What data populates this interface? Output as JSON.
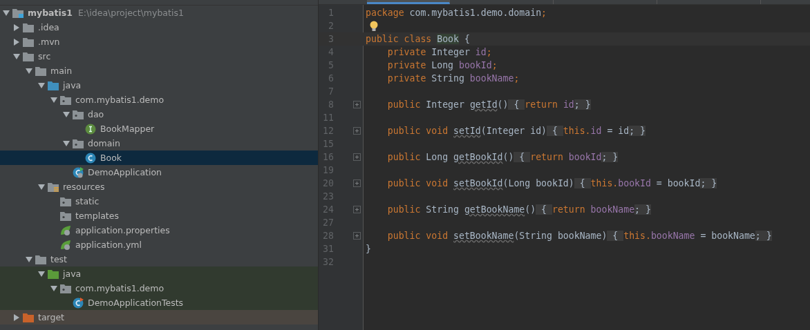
{
  "editor_tabs": [
    {
      "selected": true
    },
    {
      "selected": false
    },
    {
      "selected": false
    },
    {
      "selected": false
    }
  ],
  "project_tree": [
    {
      "label": "mybatis1",
      "path": "E:\\idea\\project\\mybatis1",
      "kind": "module",
      "expanded": true,
      "selected": false,
      "children": [
        {
          "label": ".idea",
          "kind": "folder",
          "expanded": false,
          "selected": false
        },
        {
          "label": ".mvn",
          "kind": "folder",
          "expanded": false,
          "selected": false
        },
        {
          "label": "src",
          "kind": "folder",
          "expanded": true,
          "selected": false,
          "children": [
            {
              "label": "main",
              "kind": "folder",
              "expanded": true,
              "selected": false,
              "children": [
                {
                  "label": "java",
                  "kind": "source",
                  "expanded": true,
                  "selected": false,
                  "children": [
                    {
                      "label": "com.mybatis1.demo",
                      "kind": "package",
                      "expanded": true,
                      "selected": false,
                      "children": [
                        {
                          "label": "dao",
                          "kind": "package",
                          "expanded": true,
                          "selected": false,
                          "children": [
                            {
                              "label": "BookMapper",
                              "kind": "interface",
                              "selected": false
                            }
                          ]
                        },
                        {
                          "label": "domain",
                          "kind": "package",
                          "expanded": true,
                          "selected": false,
                          "children": [
                            {
                              "label": "Book",
                              "kind": "class",
                              "selected": true
                            }
                          ]
                        },
                        {
                          "label": "DemoApplication",
                          "kind": "application",
                          "selected": false
                        }
                      ]
                    }
                  ]
                },
                {
                  "label": "resources",
                  "kind": "resources",
                  "expanded": true,
                  "selected": false,
                  "children": [
                    {
                      "label": "static",
                      "kind": "package",
                      "selected": false
                    },
                    {
                      "label": "templates",
                      "kind": "package",
                      "selected": false
                    },
                    {
                      "label": "application.properties",
                      "kind": "config",
                      "selected": false
                    },
                    {
                      "label": "application.yml",
                      "kind": "config",
                      "selected": false
                    }
                  ]
                }
              ]
            },
            {
              "label": "test",
              "kind": "folder",
              "expanded": true,
              "selected": false,
              "children": [
                {
                  "label": "java",
                  "kind": "tests",
                  "expanded": true,
                  "selected": false,
                  "test_scope": true,
                  "children": [
                    {
                      "label": "com.mybatis1.demo",
                      "kind": "package",
                      "expanded": true,
                      "selected": false,
                      "test_scope": true,
                      "children": [
                        {
                          "label": "DemoApplicationTests",
                          "kind": "testclass",
                          "selected": false,
                          "test_scope": true
                        }
                      ]
                    }
                  ]
                }
              ]
            }
          ]
        },
        {
          "label": "target",
          "kind": "excluded",
          "expanded": false,
          "selected": false,
          "excluded": true
        }
      ]
    }
  ],
  "code_lines": [
    {
      "number": "1",
      "tokens": [
        {
          "t": "package",
          "kind": "keyword"
        },
        {
          "t": " com.mybatis1.demo.domain",
          "kind": "plain"
        },
        {
          "t": ";",
          "kind": "keyword"
        }
      ]
    },
    {
      "number": "2",
      "bulb": true
    },
    {
      "number": "3",
      "current": true,
      "tokens": [
        {
          "t": "public class ",
          "kind": "keyword"
        },
        {
          "t": "Book",
          "kind": "classname"
        },
        {
          "t": " {",
          "kind": "plain"
        }
      ]
    },
    {
      "number": "4",
      "tokens": [
        {
          "t": "    private ",
          "kind": "keyword"
        },
        {
          "t": "Integer ",
          "kind": "plain"
        },
        {
          "t": "id",
          "kind": "field"
        },
        {
          "t": ";",
          "kind": "keyword"
        }
      ]
    },
    {
      "number": "5",
      "tokens": [
        {
          "t": "    private ",
          "kind": "keyword"
        },
        {
          "t": "Long ",
          "kind": "plain"
        },
        {
          "t": "bookId",
          "kind": "field"
        },
        {
          "t": ";",
          "kind": "keyword"
        }
      ]
    },
    {
      "number": "6",
      "tokens": [
        {
          "t": "    private ",
          "kind": "keyword"
        },
        {
          "t": "String ",
          "kind": "plain"
        },
        {
          "t": "bookName",
          "kind": "field"
        },
        {
          "t": ";",
          "kind": "keyword"
        }
      ]
    },
    {
      "number": "7"
    },
    {
      "number": "8",
      "folded": true,
      "tokens": [
        {
          "t": "    public ",
          "kind": "keyword"
        },
        {
          "t": "Integer ",
          "kind": "plain"
        },
        {
          "t": "getId",
          "kind": "method"
        },
        {
          "t": "()",
          "kind": "plain"
        },
        {
          "t": " { ",
          "kind": "fold"
        },
        {
          "t": "return ",
          "kind": "keyword"
        },
        {
          "t": "id",
          "kind": "field"
        },
        {
          "t": "; }",
          "kind": "fold"
        }
      ]
    },
    {
      "number": "11"
    },
    {
      "number": "12",
      "folded": true,
      "tokens": [
        {
          "t": "    public void ",
          "kind": "keyword"
        },
        {
          "t": "setId",
          "kind": "method"
        },
        {
          "t": "(Integer id)",
          "kind": "plain"
        },
        {
          "t": " { ",
          "kind": "fold"
        },
        {
          "t": "this.",
          "kind": "keyword"
        },
        {
          "t": "id",
          "kind": "field"
        },
        {
          "t": " = id",
          "kind": "plain"
        },
        {
          "t": "; }",
          "kind": "fold"
        }
      ]
    },
    {
      "number": "15"
    },
    {
      "number": "16",
      "folded": true,
      "tokens": [
        {
          "t": "    public ",
          "kind": "keyword"
        },
        {
          "t": "Long ",
          "kind": "plain"
        },
        {
          "t": "getBookId",
          "kind": "method"
        },
        {
          "t": "()",
          "kind": "plain"
        },
        {
          "t": " { ",
          "kind": "fold"
        },
        {
          "t": "return ",
          "kind": "keyword"
        },
        {
          "t": "bookId",
          "kind": "field"
        },
        {
          "t": "; }",
          "kind": "fold"
        }
      ]
    },
    {
      "number": "19"
    },
    {
      "number": "20",
      "folded": true,
      "tokens": [
        {
          "t": "    public void ",
          "kind": "keyword"
        },
        {
          "t": "setBookId",
          "kind": "method"
        },
        {
          "t": "(Long bookId)",
          "kind": "plain"
        },
        {
          "t": " { ",
          "kind": "fold"
        },
        {
          "t": "this.",
          "kind": "keyword"
        },
        {
          "t": "bookId",
          "kind": "field"
        },
        {
          "t": " = bookId",
          "kind": "plain"
        },
        {
          "t": "; }",
          "kind": "fold"
        }
      ]
    },
    {
      "number": "23"
    },
    {
      "number": "24",
      "folded": true,
      "tokens": [
        {
          "t": "    public ",
          "kind": "keyword"
        },
        {
          "t": "String ",
          "kind": "plain"
        },
        {
          "t": "getBookName",
          "kind": "method"
        },
        {
          "t": "()",
          "kind": "plain"
        },
        {
          "t": " { ",
          "kind": "fold"
        },
        {
          "t": "return ",
          "kind": "keyword"
        },
        {
          "t": "bookName",
          "kind": "field"
        },
        {
          "t": "; }",
          "kind": "fold"
        }
      ]
    },
    {
      "number": "27"
    },
    {
      "number": "28",
      "folded": true,
      "tokens": [
        {
          "t": "    public void ",
          "kind": "keyword"
        },
        {
          "t": "setBookName",
          "kind": "method"
        },
        {
          "t": "(String bookName)",
          "kind": "plain"
        },
        {
          "t": " { ",
          "kind": "fold"
        },
        {
          "t": "this.",
          "kind": "keyword"
        },
        {
          "t": "bookName",
          "kind": "field"
        },
        {
          "t": " = bookName",
          "kind": "plain"
        },
        {
          "t": "; }",
          "kind": "fold"
        }
      ]
    },
    {
      "number": "31",
      "tokens": [
        {
          "t": "}",
          "kind": "plain"
        }
      ]
    },
    {
      "number": "32"
    }
  ]
}
